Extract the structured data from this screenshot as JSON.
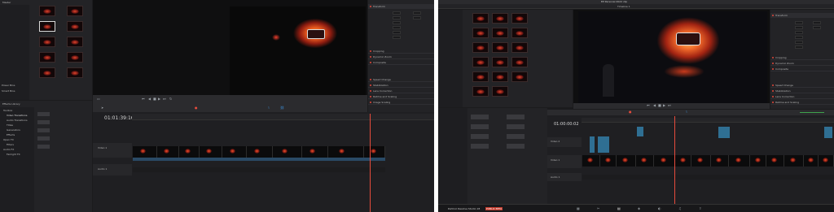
{
  "left": {
    "media_pool": {
      "tab_master": "Master",
      "bin_label": "Power Bins",
      "smart_bins": "Smart Bins"
    },
    "timecode": "01:01:39:16",
    "tracks": {
      "video1": "Video 1",
      "audio1": "Audio 1"
    },
    "inspector": {
      "transform": "Transform",
      "cropping": "Cropping",
      "dynamic_zoom": "Dynamic Zoom",
      "composite": "Composite",
      "speed_change": "Speed Change",
      "stabilization": "Stabilization",
      "lens_correction": "Lens Correction",
      "retime_scaling": "Retime and Scaling",
      "image_scaling": "Image Scaling"
    },
    "effects": {
      "header": "Toolbox",
      "video_transitions": "Video Transitions",
      "audio_transitions": "Audio Transitions",
      "titles": "Titles",
      "generators": "Generators",
      "effects": "Effects",
      "open_fx": "Open FX",
      "filters": "Filters",
      "audio_fx": "Audio FX",
      "fairlight_fx": "Fairlight FX",
      "library": "Effects Library"
    }
  },
  "right": {
    "app_title": "DaVinci Resolve Studio 18",
    "project_title": "EP Personal 2022 clip",
    "timeline_name": "Timeline 1",
    "timecode": "01:00:00:02",
    "tracks": {
      "video1": "Video 1",
      "video2": "Video 2",
      "audio1": "Audio 1"
    },
    "inspector": {
      "transform": "Transform",
      "cropping": "Cropping",
      "dynamic_zoom": "Dynamic Zoom",
      "composite": "Composite",
      "speed_change": "Speed Change",
      "stabilization": "Stabilization",
      "lens_correction": "Lens Correction",
      "retime_scaling": "Retime and Scaling",
      "image_scaling": "Image Scaling"
    },
    "footer_brand": "DaVinci Resolve Studio 18",
    "footer_badge": "PUBLIC BETA"
  },
  "colors": {
    "accent_red": "#e74b3c",
    "accent_blue": "#3d8fd6",
    "audio_blue": "#3c6e8e"
  }
}
